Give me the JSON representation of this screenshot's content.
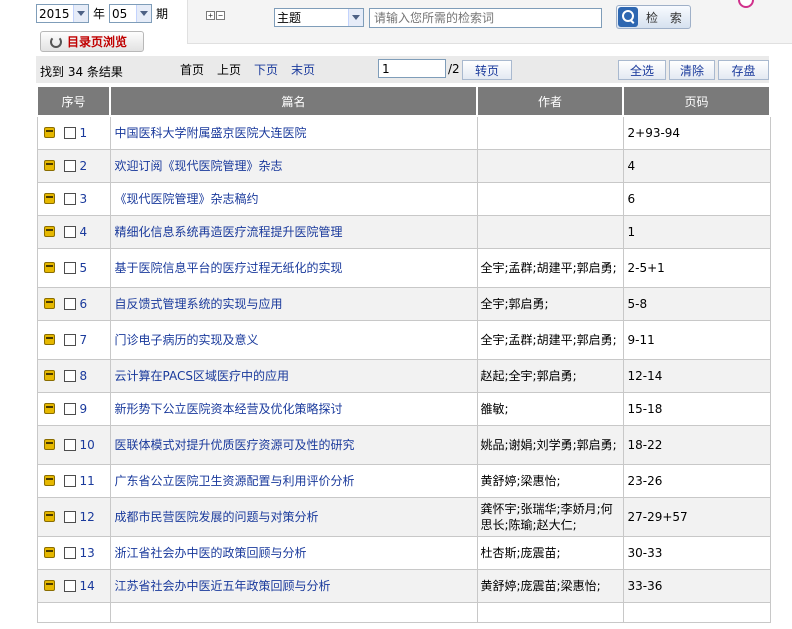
{
  "period": {
    "year": "2015",
    "year_label": "年",
    "issue": "05",
    "issue_label": "期"
  },
  "catalog_button": "目录页浏览",
  "search": {
    "expand_plus": "+",
    "expand_minus": "−",
    "field": "主题",
    "placeholder": "请输入您所需的检索词",
    "button": "检 索"
  },
  "toolbar": {
    "count_text": "找到 34 条结果",
    "first": "首页",
    "prev": "上页",
    "next": "下页",
    "last": "末页",
    "page_value": "1",
    "total_pages": "/2",
    "goto": "转页",
    "select_all": "全选",
    "clear": "清除",
    "save": "存盘"
  },
  "table": {
    "headers": [
      "序号",
      "篇名",
      "作者",
      "页码"
    ],
    "rows": [
      {
        "no": "1",
        "title": "中国医科大学附属盛京医院大连医院",
        "authors": "",
        "pages": "2+93-94"
      },
      {
        "no": "2",
        "title": "欢迎订阅《现代医院管理》杂志",
        "authors": "",
        "pages": "4"
      },
      {
        "no": "3",
        "title": "《现代医院管理》杂志稿约",
        "authors": "",
        "pages": "6"
      },
      {
        "no": "4",
        "title": "精细化信息系统再造医疗流程提升医院管理",
        "authors": "",
        "pages": "1"
      },
      {
        "no": "5",
        "title": "基于医院信息平台的医疗过程无纸化的实现",
        "authors": "全宇;孟群;胡建平;郭启勇;",
        "pages": "2-5+1"
      },
      {
        "no": "6",
        "title": "自反馈式管理系统的实现与应用",
        "authors": "全宇;郭启勇;",
        "pages": "5-8"
      },
      {
        "no": "7",
        "title": "门诊电子病历的实现及意义",
        "authors": "全宇;孟群;胡建平;郭启勇;",
        "pages": "9-11"
      },
      {
        "no": "8",
        "title": "云计算在PACS区域医疗中的应用",
        "authors": "赵起;全宇;郭启勇;",
        "pages": "12-14"
      },
      {
        "no": "9",
        "title": "新形势下公立医院资本经营及优化策略探讨",
        "authors": "雒敏;",
        "pages": "15-18"
      },
      {
        "no": "10",
        "title": "医联体模式对提升优质医疗资源可及性的研究",
        "authors": "姚品;谢娟;刘学勇;郭启勇;",
        "pages": "18-22"
      },
      {
        "no": "11",
        "title": "广东省公立医院卫生资源配置与利用评价分析",
        "authors": "黄舒婷;梁惠怡;",
        "pages": "23-26"
      },
      {
        "no": "12",
        "title": "成都市民营医院发展的问题与对策分析",
        "authors": "龚怀宇;张瑞华;李娇月;何思长;陈瑜;赵大仁;",
        "pages": "27-29+57"
      },
      {
        "no": "13",
        "title": "浙江省社会办中医的政策回顾与分析",
        "authors": "杜杏斯;庞震苗;",
        "pages": "30-33"
      },
      {
        "no": "14",
        "title": "江苏省社会办中医近五年政策回顾与分析",
        "authors": "黄舒婷;庞震苗;梁惠怡;",
        "pages": "33-36"
      },
      {
        "no": "",
        "title": "",
        "authors": "",
        "pages": ""
      }
    ]
  },
  "colors": {
    "header_bg": "#7a7a7a",
    "link": "#1a3a9c",
    "row_alt": "#f2f2f2",
    "catalog_text": "#c00000"
  }
}
